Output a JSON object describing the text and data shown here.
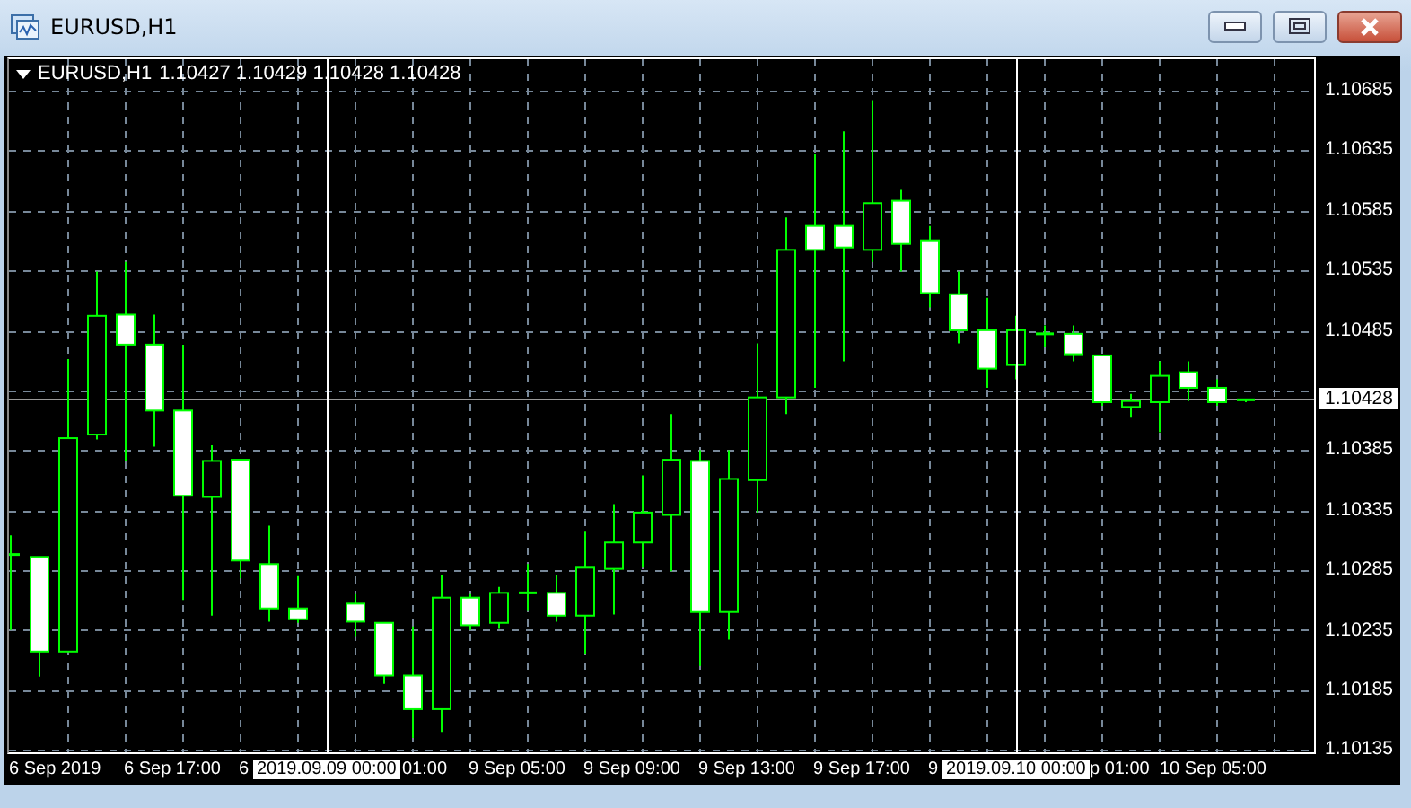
{
  "window": {
    "title": "EURUSD,H1"
  },
  "chart": {
    "symbol": "EURUSD,H1",
    "ohlc": [
      "1.10427",
      "1.10429",
      "1.10428",
      "1.10428"
    ],
    "current_price": "1.10428",
    "time_labels": [
      {
        "text": "6 Sep 2019",
        "kind": "tick"
      },
      {
        "text": "6 Sep 17:00",
        "kind": "tick"
      },
      {
        "text": "6",
        "kind": "tick"
      },
      {
        "text": "2019.09.09 00:00",
        "kind": "cursor"
      },
      {
        "text": "01:00",
        "kind": "tick"
      },
      {
        "text": "9 Sep 05:00",
        "kind": "tick"
      },
      {
        "text": "9 Sep 09:00",
        "kind": "tick"
      },
      {
        "text": "9 Sep 13:00",
        "kind": "tick"
      },
      {
        "text": "9 Sep 17:00",
        "kind": "tick"
      },
      {
        "text": "9",
        "kind": "tick"
      },
      {
        "text": "2019.09.10 00:00",
        "kind": "cursor"
      },
      {
        "text": "p 01:00",
        "kind": "tick"
      },
      {
        "text": "10 Sep 05:00",
        "kind": "tick"
      }
    ],
    "chart_data": {
      "type": "candlestick",
      "ylim": [
        1.10131,
        1.10712
      ],
      "yticks": [
        {
          "value": 1.10685,
          "label": "1.10685"
        },
        {
          "value": 1.10635,
          "label": "1.10635"
        },
        {
          "value": 1.10585,
          "label": "1.10585"
        },
        {
          "value": 1.10535,
          "label": "1.10535"
        },
        {
          "value": 1.10485,
          "label": "1.10485"
        },
        {
          "value": 1.10385,
          "label": "1.10385"
        },
        {
          "value": 1.10335,
          "label": "1.10335"
        },
        {
          "value": 1.10285,
          "label": "1.10285"
        },
        {
          "value": 1.10235,
          "label": "1.10235"
        },
        {
          "value": 1.10185,
          "label": "1.10185"
        },
        {
          "value": 1.10135,
          "label": "1.10135"
        }
      ],
      "grid": true,
      "ref_lines": [
        {
          "axis": "y",
          "value": 1.10428
        }
      ],
      "categories": [
        null,
        null,
        null,
        null,
        null,
        null,
        null,
        null,
        null,
        null,
        null,
        null,
        null,
        null,
        null,
        null,
        null,
        null,
        null,
        null,
        null,
        null,
        null,
        null,
        null,
        null,
        null,
        null,
        null,
        null,
        null,
        null,
        null,
        null,
        null,
        null,
        null,
        null,
        null,
        null,
        null,
        null,
        null,
        null
      ],
      "ohlc": [
        [
          1.10299,
          1.10315,
          1.10236,
          1.10299
        ],
        [
          1.10297,
          1.10297,
          1.10197,
          1.10218
        ],
        [
          1.10218,
          1.10462,
          1.10218,
          1.10396
        ],
        [
          1.10399,
          1.10535,
          1.10395,
          1.10498
        ],
        [
          1.10499,
          1.10543,
          1.10377,
          1.10474
        ],
        [
          1.10474,
          1.10499,
          1.10389,
          1.10419
        ],
        [
          1.10419,
          1.10474,
          1.10261,
          1.10348
        ],
        [
          1.10347,
          1.1039,
          1.10248,
          1.10377
        ],
        [
          1.10378,
          1.10378,
          1.10279,
          1.10294
        ],
        [
          1.10291,
          1.10323,
          1.10243,
          1.10254
        ],
        [
          1.10254,
          1.10281,
          1.10242,
          1.10245
        ],
        null,
        [
          1.10258,
          1.10266,
          1.10231,
          1.10243
        ],
        [
          1.10242,
          1.10242,
          1.10191,
          1.10198
        ],
        [
          1.10198,
          1.10239,
          1.10146,
          1.1017
        ],
        [
          1.1017,
          1.10282,
          1.10151,
          1.10263
        ],
        [
          1.10263,
          1.10266,
          1.10236,
          1.1024
        ],
        [
          1.10242,
          1.10272,
          1.10237,
          1.10267
        ],
        [
          1.10267,
          1.10291,
          1.10252,
          1.10267
        ],
        [
          1.10267,
          1.10282,
          1.10243,
          1.10248
        ],
        [
          1.10248,
          1.10318,
          1.10216,
          1.10288
        ],
        [
          1.10287,
          1.10341,
          1.10249,
          1.10309
        ],
        [
          1.10309,
          1.10365,
          1.10288,
          1.10334
        ],
        [
          1.10332,
          1.10416,
          1.10285,
          1.10378
        ],
        [
          1.10377,
          1.10386,
          1.10206,
          1.10251
        ],
        [
          1.10251,
          1.10386,
          1.10228,
          1.10362
        ],
        [
          1.10361,
          1.10475,
          1.10334,
          1.1043
        ],
        [
          1.1043,
          1.1058,
          1.10416,
          1.10553
        ],
        [
          1.10573,
          1.10633,
          1.10438,
          1.10553
        ],
        [
          1.10573,
          1.10652,
          1.1046,
          1.10555
        ],
        [
          1.10553,
          1.10678,
          1.10543,
          1.10592
        ],
        [
          1.10594,
          1.10603,
          1.10535,
          1.10558
        ],
        [
          1.10561,
          1.10573,
          1.10505,
          1.10517
        ],
        [
          1.10516,
          1.10535,
          1.10475,
          1.10486
        ],
        [
          1.10486,
          1.10513,
          1.10438,
          1.10454
        ],
        [
          1.10457,
          1.10498,
          1.10445,
          1.10486
        ],
        [
          1.10483,
          1.1049,
          1.10472,
          1.10483
        ],
        [
          1.10483,
          1.1049,
          1.1046,
          1.10466
        ],
        [
          1.10465,
          1.10465,
          1.10423,
          1.10426
        ],
        [
          1.10422,
          1.10433,
          1.10413,
          1.10427
        ],
        [
          1.10426,
          1.1046,
          1.10401,
          1.10448
        ],
        [
          1.10451,
          1.1046,
          1.10427,
          1.10438
        ],
        [
          1.10438,
          1.10445,
          1.10423,
          1.10426
        ],
        [
          1.10427,
          1.10429,
          1.10426,
          1.10428
        ]
      ]
    }
  }
}
